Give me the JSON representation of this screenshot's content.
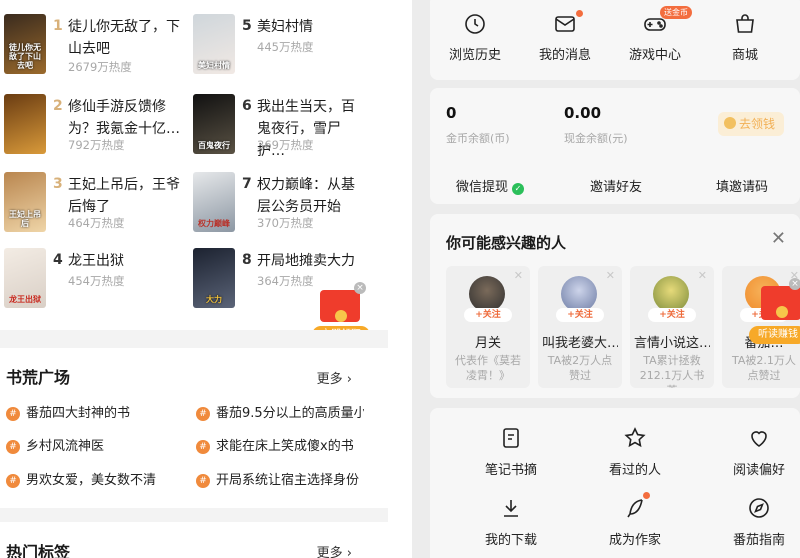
{
  "ranking": {
    "items": [
      {
        "rank": "1",
        "title": "徒儿你无敌了，下山去吧",
        "heat": "2679万热度",
        "cover_text": "徒儿你无敌了下山去吧",
        "cover_colors": [
          "#3a2b1e",
          "#9b6a2c"
        ]
      },
      {
        "rank": "2",
        "title": "修仙手游反馈修为？我氪金十亿…",
        "heat": "792万热度",
        "cover_text": "",
        "cover_colors": [
          "#6a3c12",
          "#d99a3a"
        ]
      },
      {
        "rank": "3",
        "title": "王妃上吊后，王爷后悔了",
        "heat": "464万热度",
        "cover_text": "王妃上吊后",
        "cover_colors": [
          "#b9864f",
          "#efd5a8"
        ]
      },
      {
        "rank": "4",
        "title": "龙王出狱",
        "heat": "454万热度",
        "cover_text": "龙王出狱",
        "cover_colors": [
          "#f3ece4",
          "#d9cfc6"
        ]
      },
      {
        "rank": "5",
        "title": "美妇村情",
        "heat": "445万热度",
        "cover_text": "美妇村情",
        "cover_colors": [
          "#cfd6db",
          "#f1e9e4"
        ]
      },
      {
        "rank": "6",
        "title": "我出生当天，百鬼夜行，雪尸护…",
        "heat": "369万热度",
        "cover_text": "百鬼夜行",
        "cover_colors": [
          "#111111",
          "#5a5244"
        ]
      },
      {
        "rank": "7",
        "title": "权力巅峰：从基层公务员开始",
        "heat": "370万热度",
        "cover_text": "权力巅峰",
        "cover_colors": [
          "#e6e8ea",
          "#8c97a3"
        ]
      },
      {
        "rank": "8",
        "title": "开局地摊卖大力",
        "heat": "364万热度",
        "cover_text": "大力",
        "cover_colors": [
          "#1c2230",
          "#5b6478"
        ]
      }
    ],
    "red_packet_label": "立即领取"
  },
  "book_plaza": {
    "title": "书荒广场",
    "more": "更多 ›",
    "topics": [
      "番茄四大封神的书",
      "番茄9.5分以上的高质量小",
      "乡村风流神医",
      "求能在床上笑成傻x的书",
      "男欢女爱，美女数不清",
      "开局系统让宿主选择身份"
    ],
    "hash_symbol": "#"
  },
  "hot_tags": {
    "title": "热门标签",
    "more": "更多 ›"
  },
  "quick_menu": {
    "items": [
      {
        "label": "浏览历史",
        "icon": "history-icon"
      },
      {
        "label": "我的消息",
        "icon": "message-icon"
      },
      {
        "label": "游戏中心",
        "icon": "gamepad-icon"
      },
      {
        "label": "商城",
        "icon": "shop-bag-icon"
      }
    ],
    "game_badge": "送金币"
  },
  "wallet": {
    "coins_value": "0",
    "coins_label": "金币余额(币)",
    "cash_value": "0.00",
    "cash_label": "现金余额(元)",
    "collect_button": "去领钱",
    "actions": [
      "微信提现",
      "邀请好友",
      "填邀请码"
    ],
    "wechat_check": "✓"
  },
  "people": {
    "title": "你可能感兴趣的人",
    "close": "✕",
    "follow_label": "+关注",
    "dismiss": "✕",
    "cards": [
      {
        "name": "月关",
        "desc": "代表作《莫若凌霄！》",
        "avatar_color": "#2f2f2f"
      },
      {
        "name": "叫我老婆大…",
        "desc": "TA被2万人点赞过",
        "avatar_color": "#6b7aa3"
      },
      {
        "name": "言情小说这…",
        "desc": "TA累计拯救212.1万人书荒",
        "avatar_color": "#c8b540"
      },
      {
        "name": "番茄…",
        "desc": "TA被2.1万人点赞过",
        "avatar_color": "#f08a2a"
      }
    ],
    "red_packet_label": "听读赚钱"
  },
  "tools": {
    "items": [
      {
        "label": "笔记书摘",
        "icon": "note-icon"
      },
      {
        "label": "看过的人",
        "icon": "star-icon"
      },
      {
        "label": "阅读偏好",
        "icon": "heart-icon"
      },
      {
        "label": "我的下载",
        "icon": "download-icon"
      },
      {
        "label": "成为作家",
        "icon": "feather-pen-icon"
      },
      {
        "label": "番茄指南",
        "icon": "compass-icon"
      }
    ]
  },
  "colors": {
    "accent": "#f36d3e",
    "rank_gold": "#d8b17a",
    "red_packet": "#ef3c2c"
  }
}
